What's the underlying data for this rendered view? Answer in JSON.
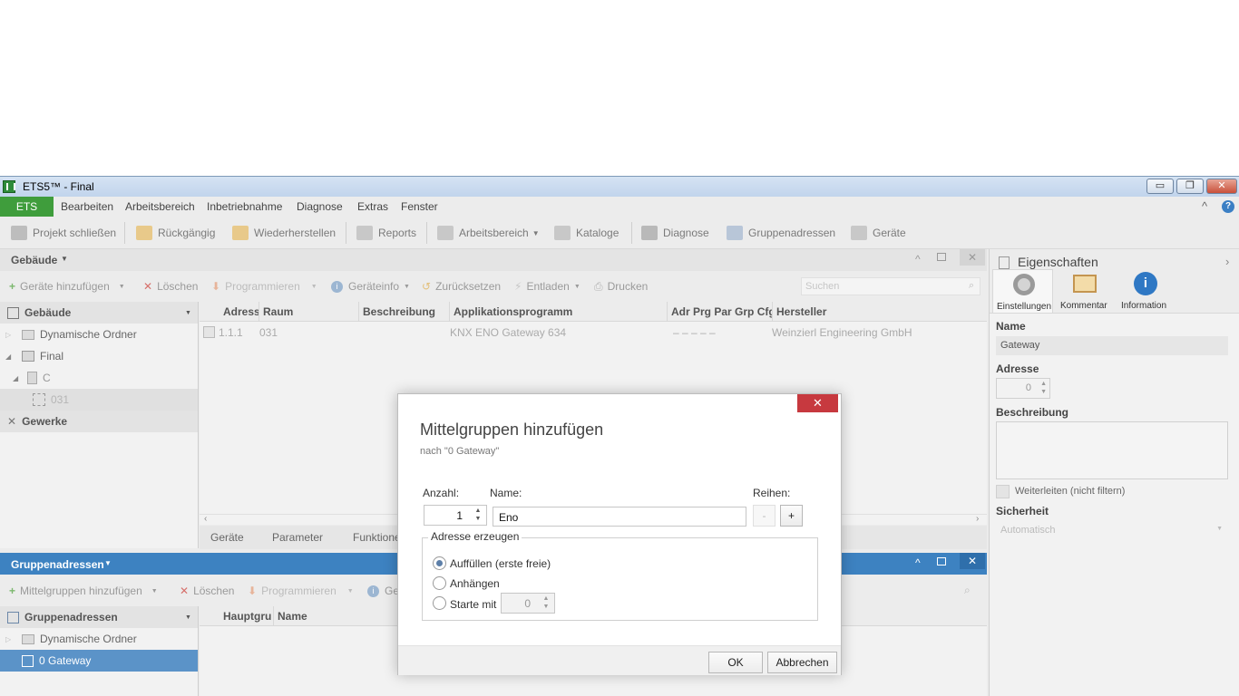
{
  "window": {
    "title": "ETS5™ - Final",
    "buttons": {
      "minimize": "▭",
      "restore": "❐",
      "close": "✕"
    }
  },
  "menubar": {
    "ets_label": "ETS",
    "items": [
      "Bearbeiten",
      "Arbeitsbereich",
      "Inbetriebnahme",
      "Diagnose",
      "Extras",
      "Fenster"
    ],
    "collapse_glyph": "^",
    "help_glyph": "?"
  },
  "toolbar": {
    "items": [
      {
        "label": "Projekt schließen",
        "icon": "close-project-icon"
      },
      {
        "label": "Rückgängig",
        "icon": "undo-icon"
      },
      {
        "label": "Wiederherstellen",
        "icon": "redo-icon"
      },
      {
        "label": "Reports",
        "icon": "printer-icon"
      },
      {
        "label": "Arbeitsbereich",
        "icon": "workspace-icon"
      },
      {
        "label": "Kataloge",
        "icon": "catalog-icon"
      },
      {
        "label": "Diagnose",
        "icon": "diagnose-icon"
      },
      {
        "label": "Gruppenadressen",
        "icon": "group-addresses-icon"
      },
      {
        "label": "Geräte",
        "icon": "devices-icon"
      }
    ]
  },
  "building_panel": {
    "title": "Gebäude",
    "actions": [
      "Geräte hinzufügen",
      "Löschen",
      "Programmieren",
      "Geräteinfo",
      "Zurücksetzen",
      "Entladen",
      "Drucken"
    ],
    "search_placeholder": "Suchen",
    "tree_header": "Gebäude",
    "tree": [
      "Dynamische Ordner",
      "Final",
      "C",
      "031"
    ],
    "tree_footer": "Gewerke",
    "columns": [
      "Adresse",
      "Raum",
      "Beschreibung",
      "Applikationsprogramm",
      "Adr Prg Par Grp Cfg",
      "Hersteller"
    ],
    "rows": [
      {
        "address": "1.1.1",
        "room": "031",
        "description": "",
        "application": "KNX ENO Gateway 634",
        "flags": "–   –   –   –   –",
        "manufacturer": "Weinzierl Engineering GmbH"
      }
    ],
    "tabs": [
      "Geräte",
      "Parameter",
      "Funktione"
    ]
  },
  "group_panel": {
    "title": "Gruppenadressen",
    "actions": [
      "Mittelgruppen hinzufügen",
      "Löschen",
      "Programmieren",
      "Ge"
    ],
    "tree_header": "Gruppenadressen",
    "tree": [
      "Dynamische Ordner",
      "0 Gateway"
    ],
    "columns": [
      "Hauptgru",
      "Name"
    ]
  },
  "properties": {
    "title": "Eigenschaften",
    "tabs": [
      "Einstellungen",
      "Kommentar",
      "Information"
    ],
    "name_label": "Name",
    "name_value": "Gateway",
    "address_label": "Adresse",
    "address_value": "0",
    "description_label": "Beschreibung",
    "forward_label": "Weiterleiten (nicht filtern)",
    "security_label": "Sicherheit",
    "security_value": "Automatisch"
  },
  "dialog": {
    "title": "Mittelgruppen hinzufügen",
    "subtitle": "nach \"0 Gateway\"",
    "count_label": "Anzahl:",
    "count_value": "1",
    "name_label": "Name:",
    "name_value": "Eno",
    "rows_label": "Reihen:",
    "minus": "-",
    "plus": "+",
    "group_legend": "Adresse erzeugen",
    "options": [
      "Auffüllen (erste freie)",
      "Anhängen",
      "Starte mit"
    ],
    "selected_option": 0,
    "start_value": "0",
    "ok": "OK",
    "cancel": "Abbrechen",
    "close_glyph": "✕"
  }
}
